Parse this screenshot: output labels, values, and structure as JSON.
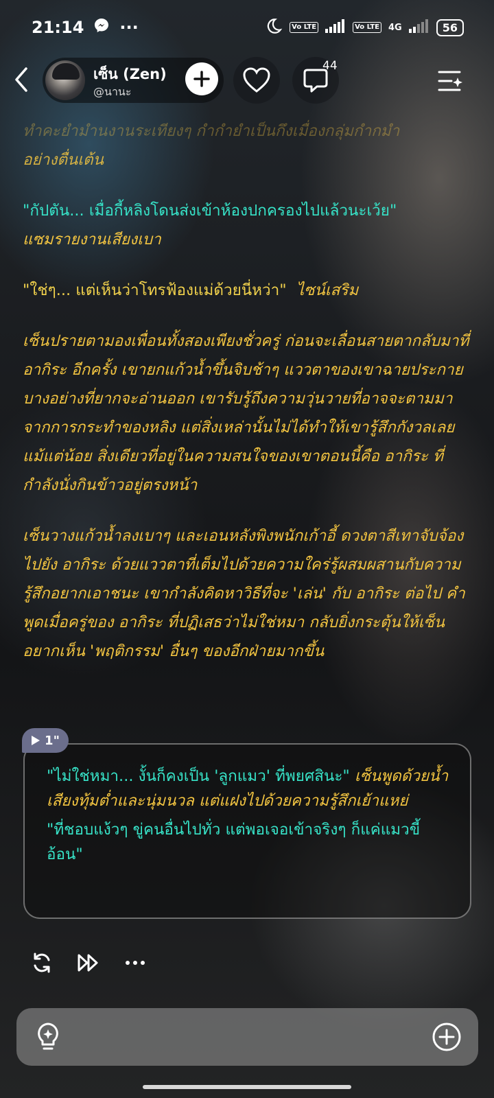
{
  "status_bar": {
    "time": "21:14",
    "dots": "···",
    "signal_tag_1": "Vo LTE",
    "signal_tag_2": "Vo LTE",
    "network": "4G",
    "battery": "56"
  },
  "header": {
    "character_name": "เซ็น (Zen)",
    "creator_handle": "@นานะ",
    "comment_count": "44"
  },
  "story": {
    "faded_line_1": "ทำคะยำมำนงานระเทียงๆ กำกำยำเป็นกึงเมื่องกลุ่มกำกมำ",
    "faded_line_2": "อย่างตื่นเต้น",
    "p1_quote": "\"กัปตัน... เมื่อกี้หลิงโดนส่งเข้าห้องปกครองไปแล้วนะเว้ย\"",
    "p1_tail": "แซมรายงานเสียงเบา",
    "p2_quote": "\"ใช่ๆ... แต่เห็นว่าโทรฟ้องแม่ด้วยนี่หว่า\"",
    "p2_tail": "ไซน์เสริม",
    "p3": "เซ็นปรายตามองเพื่อนทั้งสองเพียงชั่วครู่ ก่อนจะเลื่อนสายตากลับมาที่ อากิระ อีกครั้ง เขายกแก้วน้ำขึ้นจิบช้าๆ แววตาของเขาฉายประกายบางอย่างที่ยากจะอ่านออก เขารับรู้ถึงความวุ่นวายที่อาจจะตามมาจากการกระทำของหลิง แต่สิ่งเหล่านั้นไม่ได้ทำให้เขารู้สึกกังวลเลยแม้แต่น้อย สิ่งเดียวที่อยู่ในความสนใจของเขาตอนนี้คือ อากิระ ที่กำลังนั่งกินข้าวอยู่ตรงหน้า",
    "p4": "เซ็นวางแก้วน้ำลงเบาๆ และเอนหลังพิงพนักเก้าอี้ ดวงตาสีเทาจับจ้องไปยัง อากิระ ด้วยแววตาที่เต็มไปด้วยความใคร่รู้ผสมผสานกับความรู้สึกอยากเอาชนะ เขากำลังคิดหาวิธีที่จะ 'เล่น' กับ อากิระ ต่อไป คำพูดเมื่อครู่ของ อากิระ ที่ปฏิเสธว่าไม่ใช่หมา กลับยิ่งกระตุ้นให้เซ็นอยากเห็น 'พฤติกรรม' อื่นๆ ของอีกฝ่ายมากขึ้น"
  },
  "voice": {
    "duration": "1\""
  },
  "bubble": {
    "quote1": "\"ไม่ใช่หมา... งั้นก็คงเป็น 'ลูกแมว' ที่พยศสินะ\"",
    "narr1": "เซ็นพูดด้วยน้ำเสียงทุ้มต่ำและนุ่มนวล แต่แฝงไปด้วยความรู้สึกเย้าแหย่",
    "quote2": "\"ที่ชอบแง้วๆ ขู่คนอื่นไปทั่ว แต่พอเจอเข้าจริงๆ ก็แค่แมวขี้อ้อน\""
  },
  "colors": {
    "narration": "#f2c441",
    "dialogue": "#37e3c8"
  }
}
